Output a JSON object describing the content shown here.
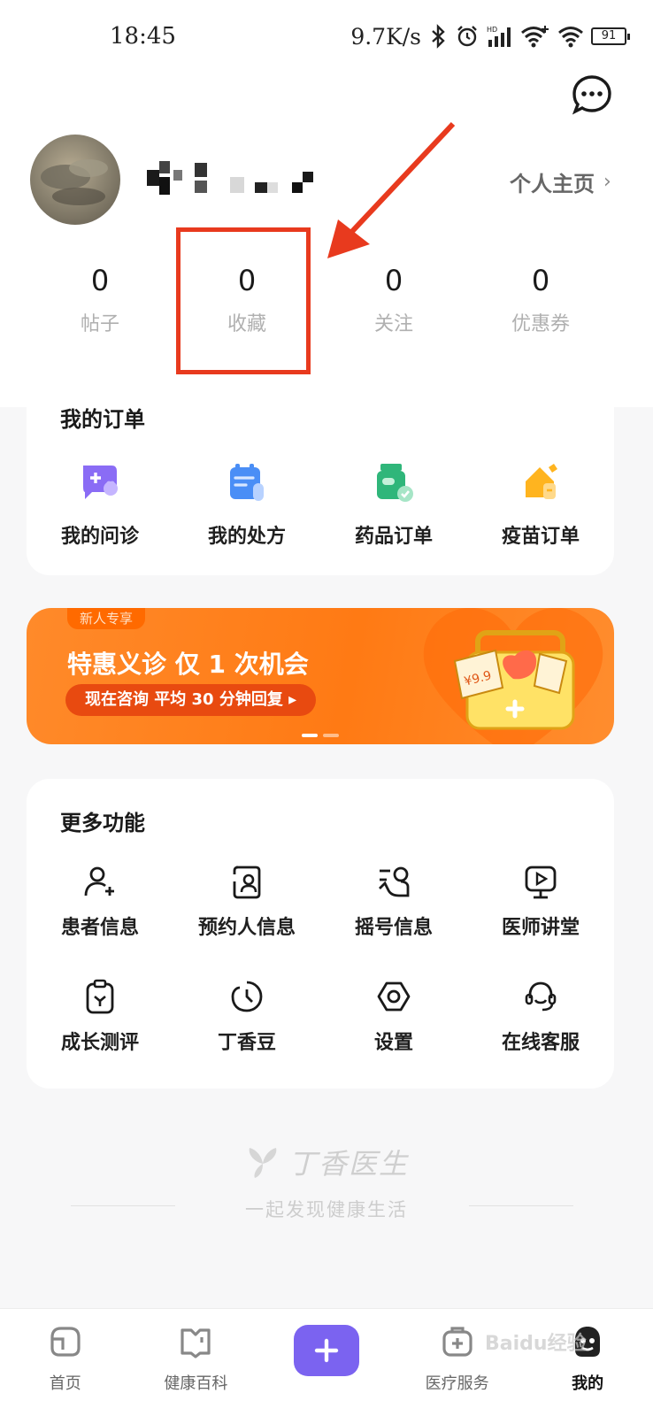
{
  "status_bar": {
    "time": "18:45",
    "net_speed": "9.7K/s",
    "battery": "91",
    "icons": [
      "bluetooth-icon",
      "alarm-icon",
      "signal-icon",
      "wifi-plus-icon",
      "wifi-icon",
      "battery-icon"
    ]
  },
  "profile": {
    "home_link": "个人主页",
    "chevron": "›"
  },
  "stats": [
    {
      "value": "0",
      "label": "帖子"
    },
    {
      "value": "0",
      "label": "收藏"
    },
    {
      "value": "0",
      "label": "关注"
    },
    {
      "value": "0",
      "label": "优惠券"
    }
  ],
  "annotation": {
    "color": "#e83a1e",
    "target": "收藏"
  },
  "orders": {
    "title": "我的订单",
    "items": [
      {
        "label": "我的问诊",
        "icon": "consult-icon"
      },
      {
        "label": "我的处方",
        "icon": "prescription-icon"
      },
      {
        "label": "药品订单",
        "icon": "medicine-icon"
      },
      {
        "label": "疫苗订单",
        "icon": "vaccine-icon"
      }
    ]
  },
  "banner": {
    "tag": "新人专享",
    "title": "特惠义诊  仅 1 次机会",
    "button": "现在咨询  平均 30 分钟回复 ▸",
    "price_tag": "¥9.9",
    "dots": 2,
    "active_dot": 0
  },
  "more": {
    "title": "更多功能",
    "row1": [
      {
        "label": "患者信息",
        "icon": "patient-icon"
      },
      {
        "label": "预约人信息",
        "icon": "appointment-person-icon"
      },
      {
        "label": "摇号信息",
        "icon": "lottery-icon"
      },
      {
        "label": "医师讲堂",
        "icon": "lecture-icon"
      }
    ],
    "row2": [
      {
        "label": "成长测评",
        "icon": "growth-test-icon"
      },
      {
        "label": "丁香豆",
        "icon": "bean-icon"
      },
      {
        "label": "设置",
        "icon": "settings-icon"
      },
      {
        "label": "在线客服",
        "icon": "customer-service-icon"
      }
    ]
  },
  "brand": {
    "name": "丁香医生",
    "slogan": "一起发现健康生活"
  },
  "bottom_nav": [
    {
      "label": "首页",
      "icon": "home-icon",
      "active": false
    },
    {
      "label": "健康百科",
      "icon": "encyclopedia-icon",
      "active": false
    },
    {
      "label": "",
      "icon": "plus-icon",
      "active": false
    },
    {
      "label": "医疗服务",
      "icon": "medical-service-icon",
      "active": false
    },
    {
      "label": "我的",
      "icon": "profile-icon",
      "active": true
    }
  ],
  "watermark": "Baidu经验",
  "colors": {
    "accent_purple": "#7b63f0",
    "banner_orange": "#ff7a14",
    "annotation_red": "#e83a1e",
    "background": "#f7f7f8"
  }
}
